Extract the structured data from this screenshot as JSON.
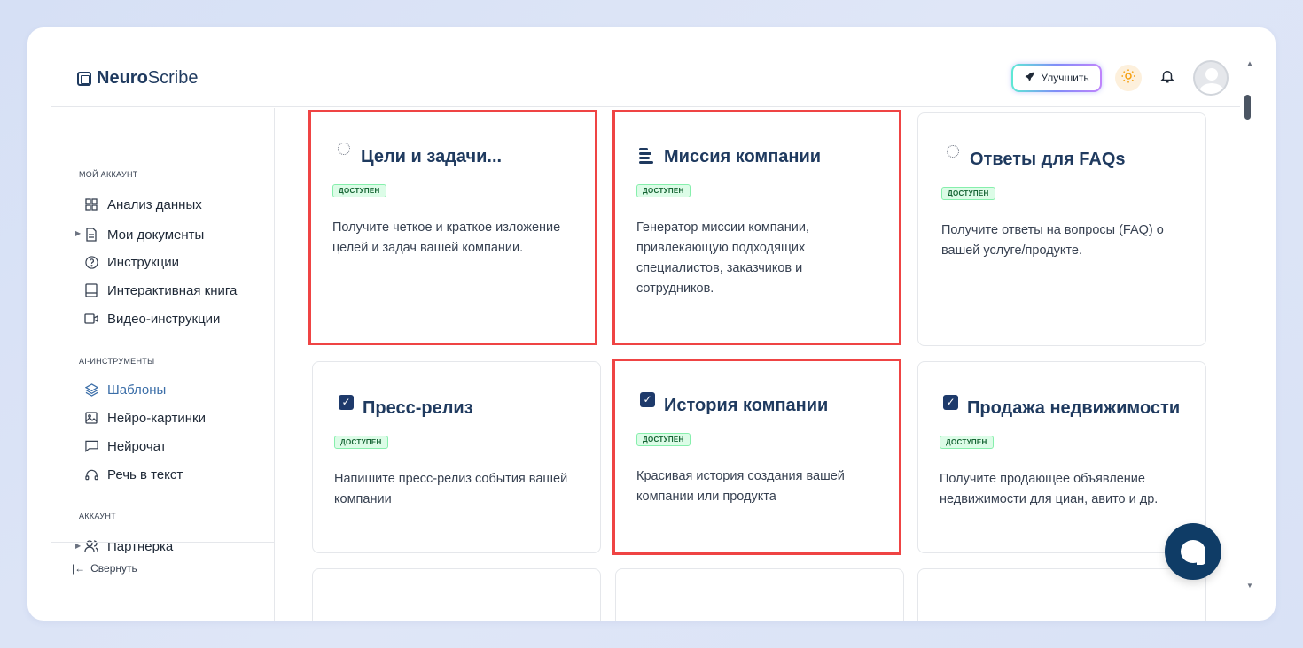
{
  "header": {
    "logo_bold": "Neuro",
    "logo_light": "Scribe",
    "upgrade_label": "Улучшить"
  },
  "sidebar": {
    "sections": [
      {
        "title": "МОЙ АККАУНТ"
      },
      {
        "title": "AI-ИНСТРУМЕНТЫ"
      },
      {
        "title": "АККАУНТ"
      }
    ],
    "items": [
      {
        "label": "Анализ данных",
        "icon": "grid-icon"
      },
      {
        "label": "Мои документы",
        "icon": "document-icon"
      },
      {
        "label": "Инструкции",
        "icon": "help-circle-icon"
      },
      {
        "label": "Интерактивная книга",
        "icon": "book-icon"
      },
      {
        "label": "Видео-инструкции",
        "icon": "video-icon"
      },
      {
        "label": "Шаблоны",
        "icon": "layers-icon",
        "active": true
      },
      {
        "label": "Нейро-картинки",
        "icon": "image-icon"
      },
      {
        "label": "Нейрочат",
        "icon": "chat-icon"
      },
      {
        "label": "Речь в текст",
        "icon": "headphones-icon"
      },
      {
        "label": "Партнерка",
        "icon": "users-icon"
      }
    ],
    "collapse_label": "Свернуть"
  },
  "cards": [
    {
      "title": "Цели и задачи...",
      "badge": "ДОСТУПЕН",
      "desc": "Получите четкое и краткое изложение целей и задач вашей компании.",
      "icon": "document-circle-icon"
    },
    {
      "title": "Миссия компании",
      "badge": "ДОСТУПЕН",
      "desc": "Генератор миссии компании, привлекающую подходящих специалистов, заказчиков и сотрудников.",
      "icon": "text-lines-icon"
    },
    {
      "title": "Ответы для FAQs",
      "badge": "ДОСТУПЕН",
      "desc": "Получите ответы на вопросы (FAQ) о вашей услуге/продукте.",
      "icon": "document-circle-icon"
    },
    {
      "title": "Пресс-релиз",
      "badge": "ДОСТУПЕН",
      "desc": "Напишите пресс-релиз события вашей компании",
      "icon": "checkbox-icon"
    },
    {
      "title": "История компании",
      "badge": "ДОСТУПЕН",
      "desc": "Красивая история создания вашей компании или продукта",
      "icon": "checkbox-icon"
    },
    {
      "title": "Продажа недвижимости",
      "badge": "ДОСТУПЕН",
      "desc": "Получите продающее объявление недвижимости для циан, авито и др.",
      "icon": "checkbox-icon"
    }
  ],
  "colors": {
    "highlight": "#ef4444",
    "badge_bg": "#dcfce7",
    "brand": "#1f3a5f",
    "chat_button": "#0f3c66"
  }
}
